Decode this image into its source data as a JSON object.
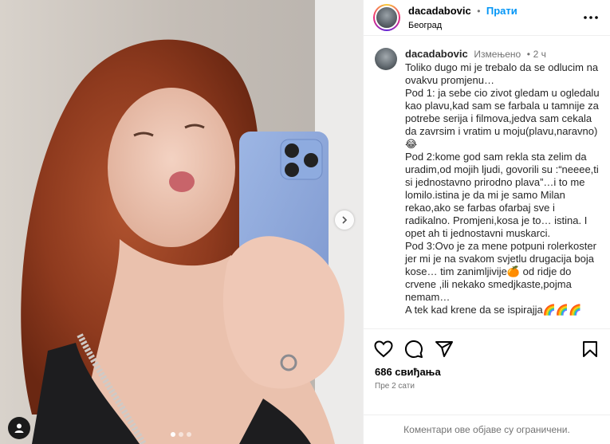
{
  "post": {
    "username": "dacadabovic",
    "separator": "•",
    "follow_label": "Прати",
    "location": "Београд",
    "more_label": "•••"
  },
  "caption": {
    "username": "dacadabovic",
    "edited_label": "Измењено",
    "separator": "•",
    "time": "2 ч",
    "text": "Toliko dugo mi je trebalo da se odlucim na ovakvu promjenu…\nPod 1: ja sebe cio zivot gledam u ogledalu kao plavu,kad sam se farbala u tamnije za potrebe serija i filmova,jedva sam cekala da zavrsim i vratim u moju(plavu,naravno)😂\nPod 2:kome god sam rekla sta zelim da uradim,od mojih ljudi, govorili su :“neeee,ti si jednostavno prirodno plava”…i to me lomilo.istina je da mi je samo Milan rekao,ako se farbas ofarbaj sve i radikalno. Promjeni,kosa je to… istina. I opet ah ti jednostavni muskarci.\nPod 3:Ovo je za mene potpuni rolerkoster jer mi je na svakom svjetlu drugacija boja kose… tim zanimljivije🍊 od ridje do crvene ,ili nekako smedjkaste,pojma nemam…\nA tek kad krene da se ispirajja🌈🌈🌈"
  },
  "actions": {
    "like_icon": "heart-icon",
    "comment_icon": "comment-icon",
    "share_icon": "share-icon",
    "save_icon": "bookmark-icon"
  },
  "stats": {
    "likes": "686 свиђања",
    "posted_ago": "Пре 2 сати"
  },
  "comments_limited": "Коментари ове објаве су ограничени.",
  "carousel": {
    "slide_count": 3,
    "active_index": 0
  },
  "colors": {
    "accent": "#0095f6",
    "muted": "#737373",
    "border": "#efefef"
  }
}
